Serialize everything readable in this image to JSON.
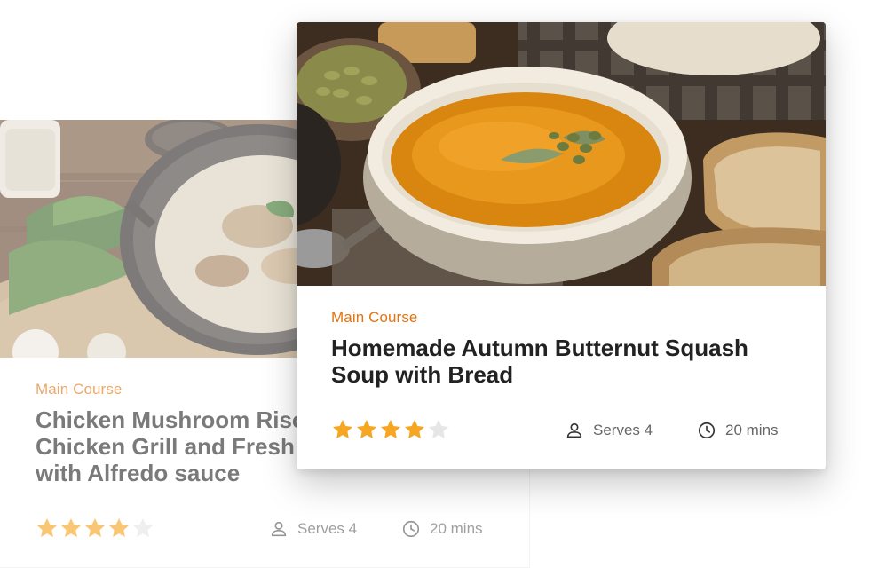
{
  "cards": [
    {
      "category": "Main Course",
      "title_line1": "Chicken Mushroom Risotto",
      "title_line2": "Chicken Grill and Fresh",
      "title_line3": "with Alfredo sauce",
      "rating": 4,
      "rating_max": 5,
      "serves": "Serves 4",
      "time": "20 mins",
      "image": "risotto-photo"
    },
    {
      "category": "Main Course",
      "title_line1": "Homemade Autumn Butternut Squash",
      "title_line2": "Soup with Bread",
      "rating": 4,
      "rating_max": 5,
      "serves": "Serves 4",
      "time": "20 mins",
      "image": "squash-soup-photo"
    }
  ],
  "icons": {
    "serves": "person-icon",
    "time": "clock-icon",
    "star": "star-icon"
  },
  "colors": {
    "category": "#e2740f",
    "star_filled": "#f5a623",
    "star_empty": "#e6e6e6",
    "title": "#222222",
    "meta": "#666666"
  }
}
